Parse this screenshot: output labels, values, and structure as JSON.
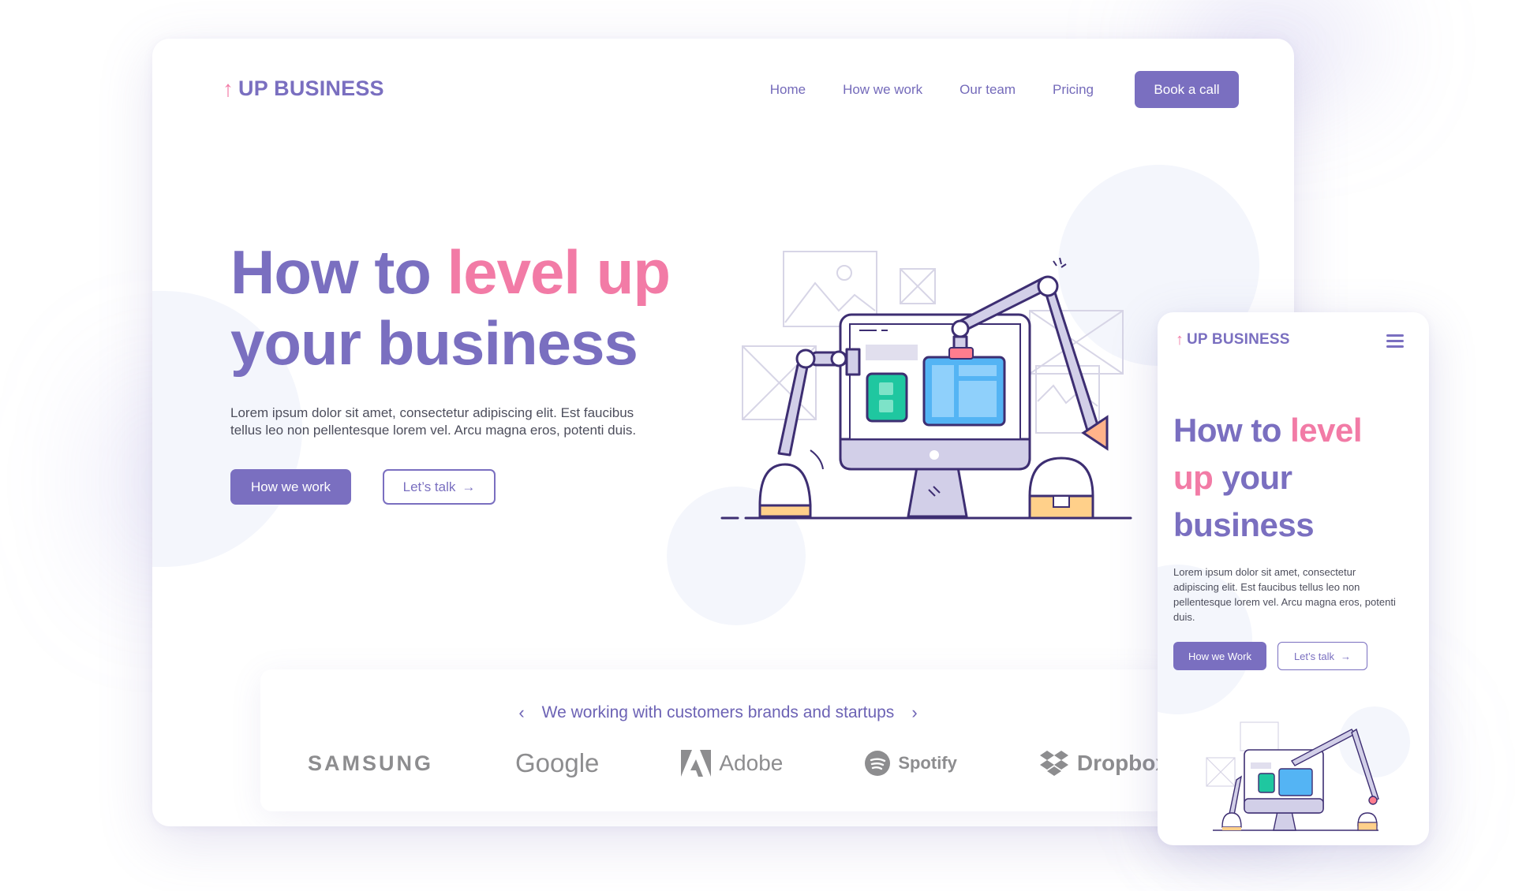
{
  "desktop": {
    "logo": {
      "arrow": "↑",
      "text": "UP BUSINESS"
    },
    "nav": {
      "links": [
        "Home",
        "How we work",
        "Our team",
        "Pricing"
      ],
      "cta": "Book a call"
    },
    "hero": {
      "title_part1": "How to ",
      "title_highlight": "level up",
      "title_part2": "your business",
      "description": "Lorem ipsum dolor sit amet, consectetur adipiscing elit. Est faucibus tellus leo non pellentesque lorem vel. Arcu magna eros, potenti duis.",
      "primary_button": "How we work",
      "secondary_button": "Let’s talk",
      "arrow": "→"
    },
    "brands": {
      "heading": "We working with customers brands and startups",
      "prev": "‹",
      "next": "›",
      "logos": [
        "SAMSUNG",
        "Google",
        "Adobe",
        "Spotify",
        "Dropbox"
      ]
    }
  },
  "mobile": {
    "logo": {
      "arrow": "↑",
      "text": "UP BUSINESS"
    },
    "menu_icon": "hamburger-icon",
    "hero": {
      "title_part1": "How to ",
      "title_highlight1": "level",
      "title_highlight2": "up",
      "title_part2": " your business",
      "description": "Lorem ipsum dolor sit amet, consectetur adipiscing elit. Est faucibus tellus leo non pellentesque lorem vel. Arcu magna eros, potenti duis.",
      "primary_button": "How we Work",
      "secondary_button": "Let’s talk",
      "arrow": "→"
    }
  },
  "colors": {
    "primary": "#7a6fc0",
    "accent": "#f27ba6",
    "text": "#4d4e5c",
    "teal": "#1fc7a0",
    "blue": "#54b4f4",
    "yellow": "#ffd08a"
  }
}
